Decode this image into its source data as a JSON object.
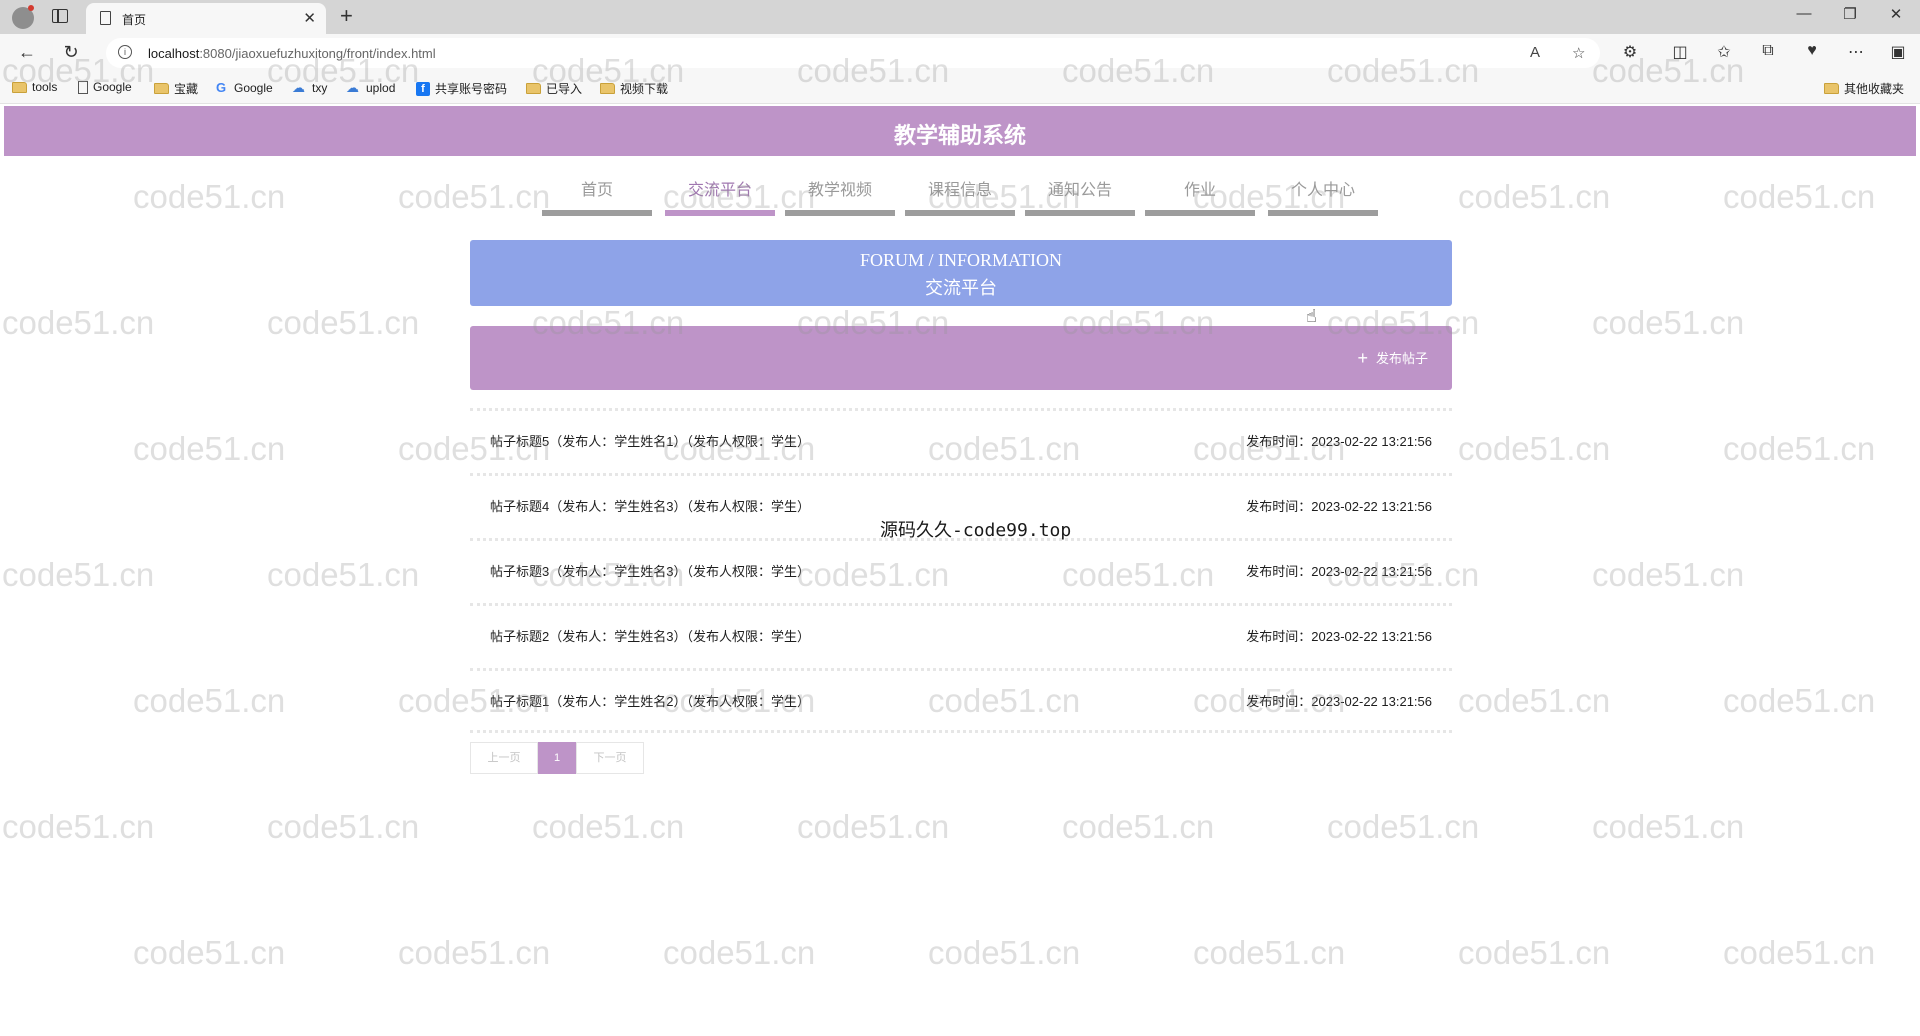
{
  "browser": {
    "tab_title": "首页",
    "url_host": "localhost",
    "url_rest": ":8080/jiaoxuefuzhuxitong/front/index.html",
    "bookmarks": [
      {
        "type": "folder",
        "label": "tools"
      },
      {
        "type": "page",
        "label": "Google"
      },
      {
        "type": "folder",
        "label": "宝藏"
      },
      {
        "type": "google",
        "label": "Google"
      },
      {
        "type": "cloud",
        "label": "txy"
      },
      {
        "type": "cloud",
        "label": "uplod"
      },
      {
        "type": "f",
        "label": "共享账号密码"
      },
      {
        "type": "folder",
        "label": "已导入"
      },
      {
        "type": "folder",
        "label": "视频下载"
      }
    ],
    "other_bookmarks": "其他收藏夹"
  },
  "site": {
    "title": "教学辅助系统"
  },
  "nav": {
    "items": [
      {
        "label": "首页",
        "active": false
      },
      {
        "label": "交流平台",
        "active": true
      },
      {
        "label": "教学视频",
        "active": false
      },
      {
        "label": "课程信息",
        "active": false
      },
      {
        "label": "通知公告",
        "active": false
      },
      {
        "label": "作业",
        "active": false
      },
      {
        "label": "个人中心",
        "active": false
      }
    ]
  },
  "banner": {
    "en": "FORUM / INFORMATION",
    "cn": "交流平台"
  },
  "actions": {
    "post_label": "发布帖子"
  },
  "posts": [
    {
      "title": "帖子标题5（发布人：学生姓名1）（发布人权限：学生）",
      "time": "发布时间：2023-02-22 13:21:56"
    },
    {
      "title": "帖子标题4（发布人：学生姓名3）（发布人权限：学生）",
      "time": "发布时间：2023-02-22 13:21:56"
    },
    {
      "title": "帖子标题3（发布人：学生姓名3）（发布人权限：学生）",
      "time": "发布时间：2023-02-22 13:21:56"
    },
    {
      "title": "帖子标题2（发布人：学生姓名3）（发布人权限：学生）",
      "time": "发布时间：2023-02-22 13:21:56"
    },
    {
      "title": "帖子标题1（发布人：学生姓名2）（发布人权限：学生）",
      "time": "发布时间：2023-02-22 13:21:56"
    }
  ],
  "pager": {
    "prev": "上一页",
    "current": "1",
    "next": "下一页"
  },
  "watermark": {
    "text": "code51.cn",
    "center_text": "源码久久-code99.top"
  },
  "colors": {
    "header": "#be94c8",
    "banner": "#8ea3e8",
    "nav_bar": "#9d9d9d"
  }
}
